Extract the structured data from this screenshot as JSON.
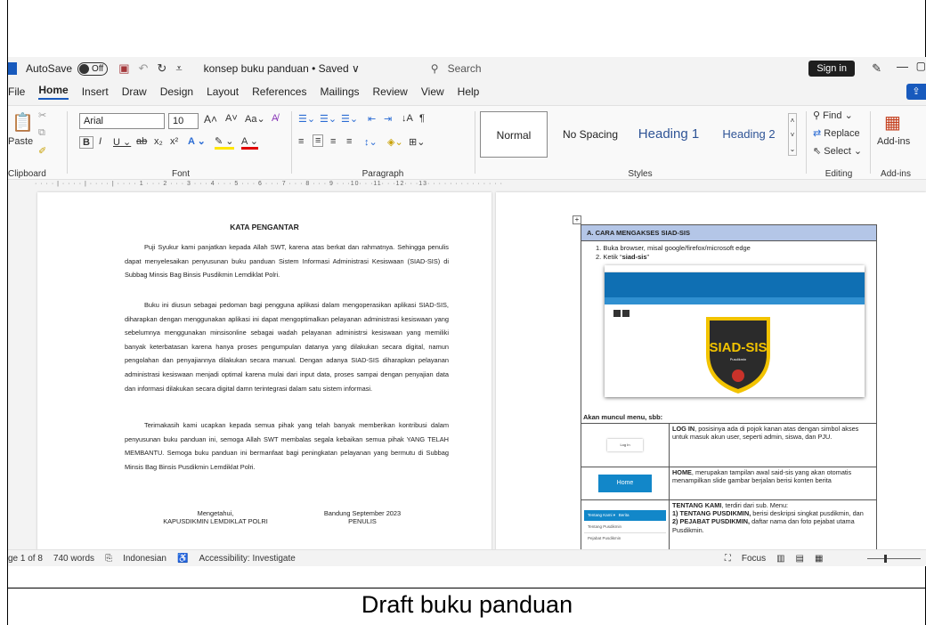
{
  "app": {
    "autosave_label": "AutoSave",
    "autosave_state": "Off",
    "doc_title": "konsep buku panduan • Saved ∨",
    "search_placeholder": "Search",
    "sign_in": "Sign in"
  },
  "tabs": [
    "File",
    "Home",
    "Insert",
    "Draw",
    "Design",
    "Layout",
    "References",
    "Mailings",
    "Review",
    "View",
    "Help"
  ],
  "ribbon": {
    "clipboard": {
      "paste": "Paste",
      "label": "Clipboard"
    },
    "font": {
      "name": "Arial",
      "size": "10",
      "label": "Font"
    },
    "paragraph": {
      "label": "Paragraph"
    },
    "styles": {
      "items": [
        "Normal",
        "No Spacing",
        "Heading 1",
        "Heading 2"
      ],
      "label": "Styles"
    },
    "editing": {
      "find": "Find",
      "replace": "Replace",
      "select": "Select",
      "label": "Editing"
    },
    "addins": {
      "btn": "Add-ins",
      "label": "Add-ins"
    }
  },
  "ruler_text": "· · · · | · · · · | · · · · | · · · · 1 · · · 2 · · · 3 · · · 4 · · · 5 · · · 6 · · · 7 · · · 8 · · · 9 · · ·10· · ·11· · ·12· · ·13· · · · · · · · · · · · · ·",
  "page1": {
    "title": "KATA PENGANTAR",
    "para1": "Puji Syukur kami panjatkan kepada Allah SWT, karena atas berkat dan rahmatnya. Sehingga penulis dapat menyelesaikan penyusunan buku panduan Sistem Informasi Administrasi Kesiswaan (SIAD-SIS) di Subbag Minsis Bag Binsis Pusdikmin Lemdiklat Polri.",
    "para2": "Buku ini diusun sebagai pedoman bagi pengguna aplikasi dalam mengoperasikan aplikasi SIAD-SIS, diharapkan dengan menggunakan aplikasi ini dapat mengoptimalkan pelayanan administrasi kesiswaan yang sebelumnya menggunakan minsisonline sebagai wadah pelayanan administrsi kesiswaan yang memiliki banyak keterbatasan karena hanya proses pengumpulan datanya yang dilakukan secara digital, namun pengolahan dan penyajiannya dilakukan secara manual. Dengan adanya SIAD-SIS diharapkan pelayanan administrasi kesiswaan menjadi optimal karena mulai dari input data, proses sampai dengan penyajian data dan informasi dilakukan secara digital damn terintegrasi dalam satu sistem informasi.",
    "para3": "Terimakasih kami ucapkan kepada semua pihak yang telah banyak memberikan kontribusi dalam penyusunan buku panduan ini, semoga Allah SWT membalas segala kebaikan semua pihak YANG TELAH MEMBANTU. Semoga buku panduan ini bermanfaat bagi peningkatan pelayanan yang bermutu di Subbag Minsis Bag Binsis Pusdikmin Lemdiklat Polri.",
    "sig_left_1": "Mengetahui,",
    "sig_left_2": "KAPUSDIKMIN LEMDIKLAT POLRI",
    "sig_right_1": "Bandung     September 2023",
    "sig_right_2": "PENULIS"
  },
  "page2": {
    "header": "A.   CARA MENGAKSES SIAD-SIS",
    "step1": "1.   Buka browser, misal google/firefox/microsoft edge",
    "step2_pre": "2.   Ketik “",
    "step2_bold": "siad-sis",
    "step2_post": "”",
    "shot_siad": "SIAD-SIS",
    "shot_pusdikmin": "Pusdikmin",
    "akan": "Akan muncul menu, sbb:",
    "login_btn": "Log In",
    "login_b": "LOG IN",
    "login_desc": ", posisinya ada di pojok kanan atas dengan simbol akses untuk masuk akun user, seperti admin, siswa, dan PJU.",
    "home_btn": "Home",
    "home_b": "HOME",
    "home_desc": ", merupakan tampilan awal said-sis yang akan otomatis menampilkan slide gambar berjalan berisi konten berita",
    "tk_menu": "Tentang Kami ▾",
    "tk_berita": "Berita",
    "tk_item1": "Tentang Pusdikmin",
    "tk_item2": "Pejabat Pusdikmin",
    "tk_b": "TENTANG KAMI",
    "tk_desc": ", terdiri dari sub. Menu:",
    "tk_sub1_b": "1)  TENTANG PUSDIKMIN,",
    "tk_sub1": " berisi deskripsi singkat pusdikmin, dan",
    "tk_sub2_b": "2)  PEJABAT PUSDIKMIN,",
    "tk_sub2": " daftar nama dan foto pejabat utama Pusdikmin."
  },
  "status": {
    "page": "ge 1 of 8",
    "words": "740 words",
    "lang": "Indonesian",
    "access": "Accessibility: Investigate",
    "focus": "Focus"
  },
  "caption": "Draft buku panduan"
}
